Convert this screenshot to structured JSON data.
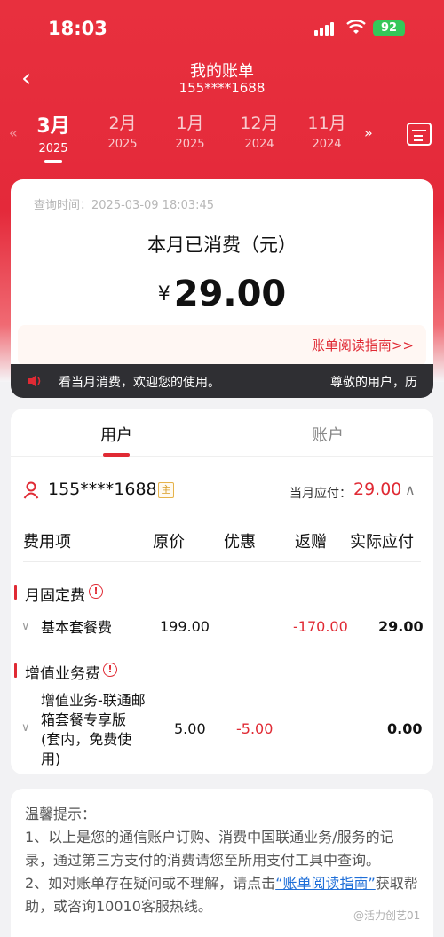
{
  "status_bar": {
    "time": "18:03",
    "battery": "92"
  },
  "header": {
    "title": "我的账单",
    "phone": "155****1688",
    "back_icon": "chevron-left-icon"
  },
  "months": [
    {
      "month": "3月",
      "year": "2025",
      "active": true
    },
    {
      "month": "2月",
      "year": "2025"
    },
    {
      "month": "1月",
      "year": "2025"
    },
    {
      "month": "12月",
      "year": "2024"
    },
    {
      "month": "11月",
      "year": "2024"
    }
  ],
  "summary": {
    "query_time": "查询时间：2025-03-09 18:03:45",
    "label": "本月已消费（元）",
    "currency": "¥",
    "amount": "29.00",
    "guide": "账单阅读指南>>"
  },
  "notice": {
    "text_left": "看当月消费，欢迎您的使用。",
    "text_right": "尊敬的用户，历"
  },
  "tabs": [
    "用户",
    "账户"
  ],
  "user_row": {
    "number": "155****1688",
    "badge": "主",
    "due_label": "当月应付：",
    "due_value": "29.00"
  },
  "table": {
    "headers": [
      "费用项",
      "原价",
      "优惠",
      "返赠",
      "实际应付"
    ],
    "sections": [
      {
        "title": "月固定费",
        "info": "!",
        "rows": [
          {
            "name": "基本套餐费",
            "original": "199.00",
            "discount": "",
            "refund": "-170.00",
            "actual": "29.00"
          }
        ]
      },
      {
        "title": "增值业务费",
        "info": "!",
        "rows": [
          {
            "name": "增值业务-联通邮箱套餐专享版(套内，免费使用)",
            "original": "5.00",
            "discount": "-5.00",
            "refund": "",
            "actual": "0.00"
          }
        ]
      }
    ]
  },
  "tips": {
    "title": "温馨提示：",
    "line1": "1、以上是您的通信账户订购、消费中国联通业务/服务的记录，通过第三方支付的消费请您至所用支付工具中查询。",
    "line2_pre": "2、如对账单存在疑问或不理解，请点击",
    "line2_link": "“账单阅读指南”",
    "line2_post": "获取帮助，或咨询10010客服热线。"
  },
  "watermark": "@活力创艺01",
  "colors": {
    "brand_red": "#e4293a",
    "accent_red": "#e02a34",
    "link_blue": "#1f6fd8"
  }
}
